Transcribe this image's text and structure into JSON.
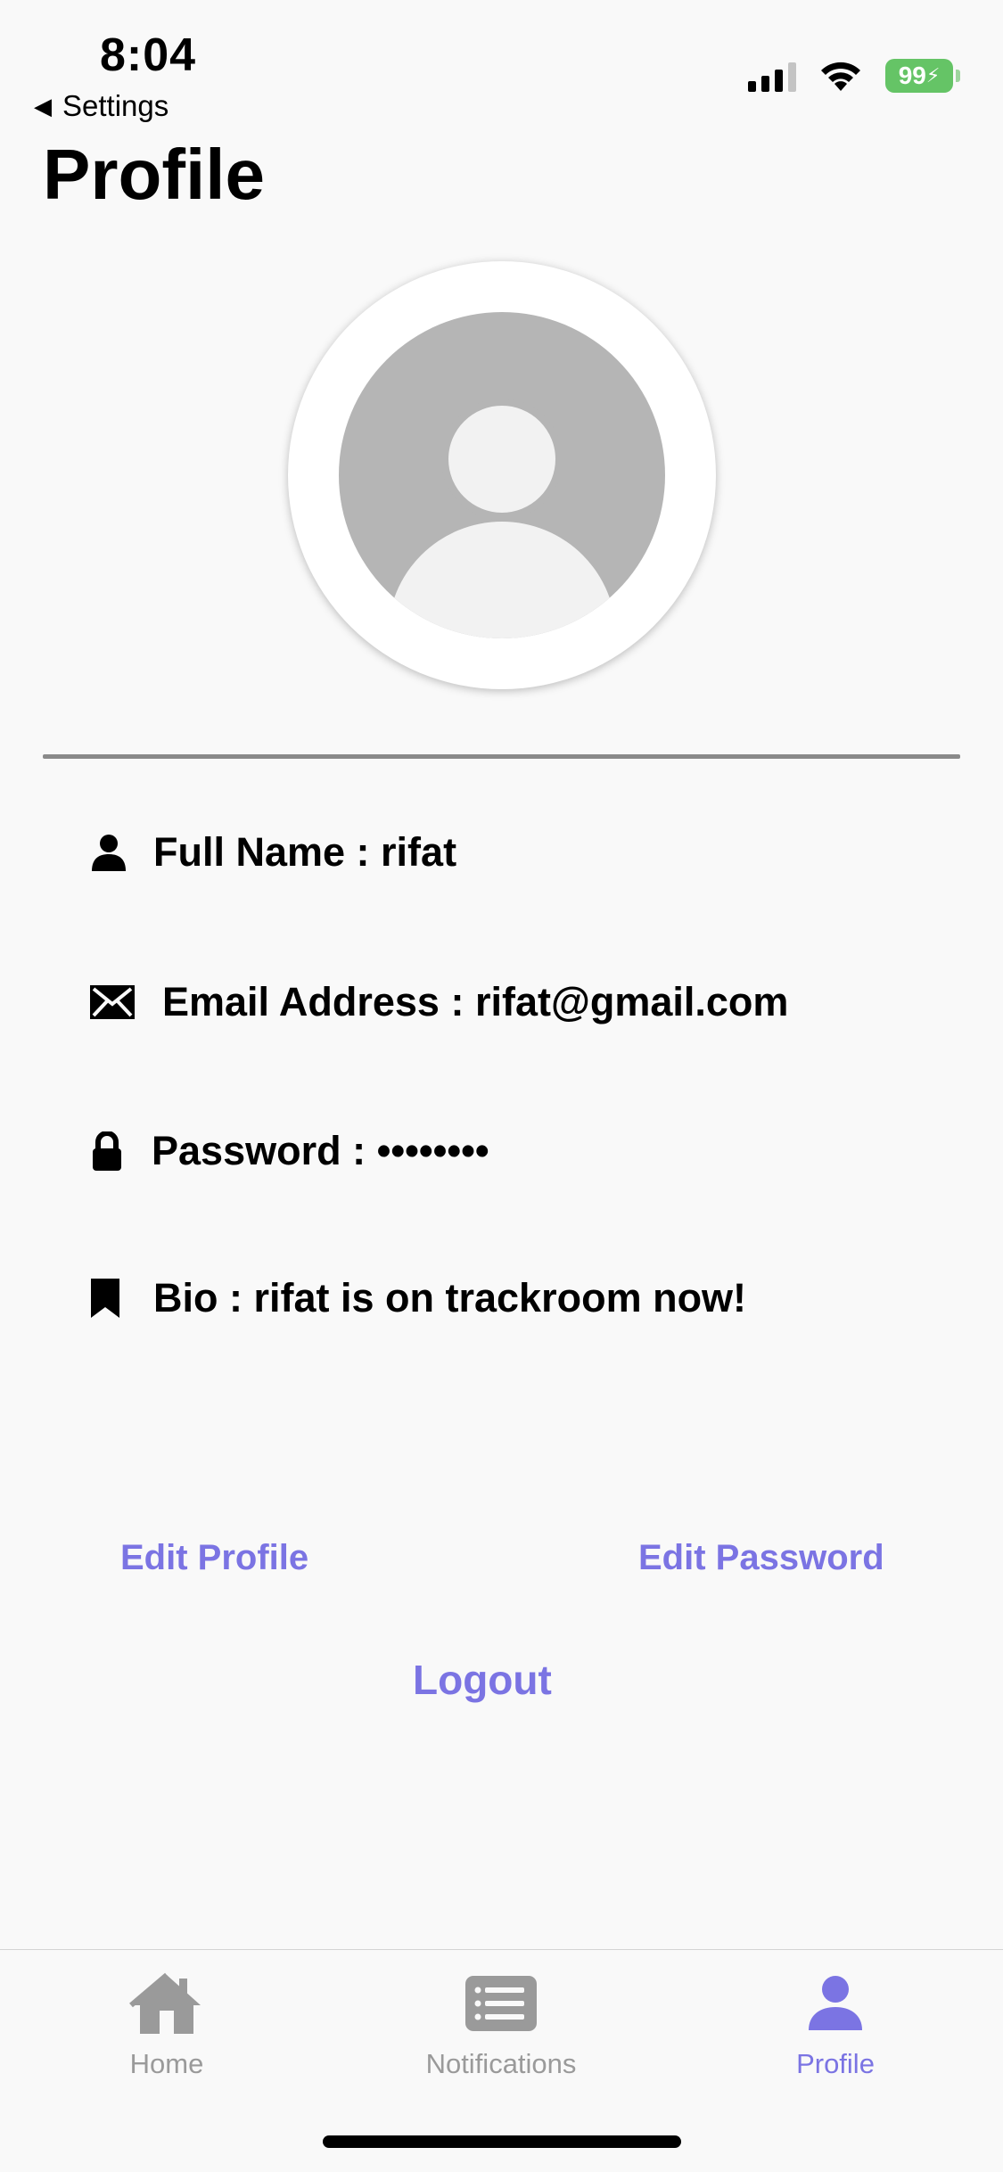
{
  "status_bar": {
    "time": "8:04",
    "back_label": "Settings",
    "battery": "99"
  },
  "page": {
    "title": "Profile"
  },
  "avatar": {
    "icon": "person-placeholder"
  },
  "profile": {
    "full_name": "Full Name : rifat",
    "email": "Email Address : rifat@gmail.com",
    "password": "Password : ••••••••",
    "bio": "Bio : rifat is on trackroom now!"
  },
  "actions": {
    "edit_profile": "Edit Profile",
    "edit_password": "Edit Password",
    "logout": "Logout"
  },
  "tabs": [
    {
      "label": "Home",
      "icon": "home-icon",
      "active": false
    },
    {
      "label": "Notifications",
      "icon": "list-icon",
      "active": false
    },
    {
      "label": "Profile",
      "icon": "person-icon",
      "active": true
    }
  ],
  "colors": {
    "accent": "#7b74e3",
    "inactive_tab": "#9a9a9a",
    "battery": "#65c466"
  }
}
